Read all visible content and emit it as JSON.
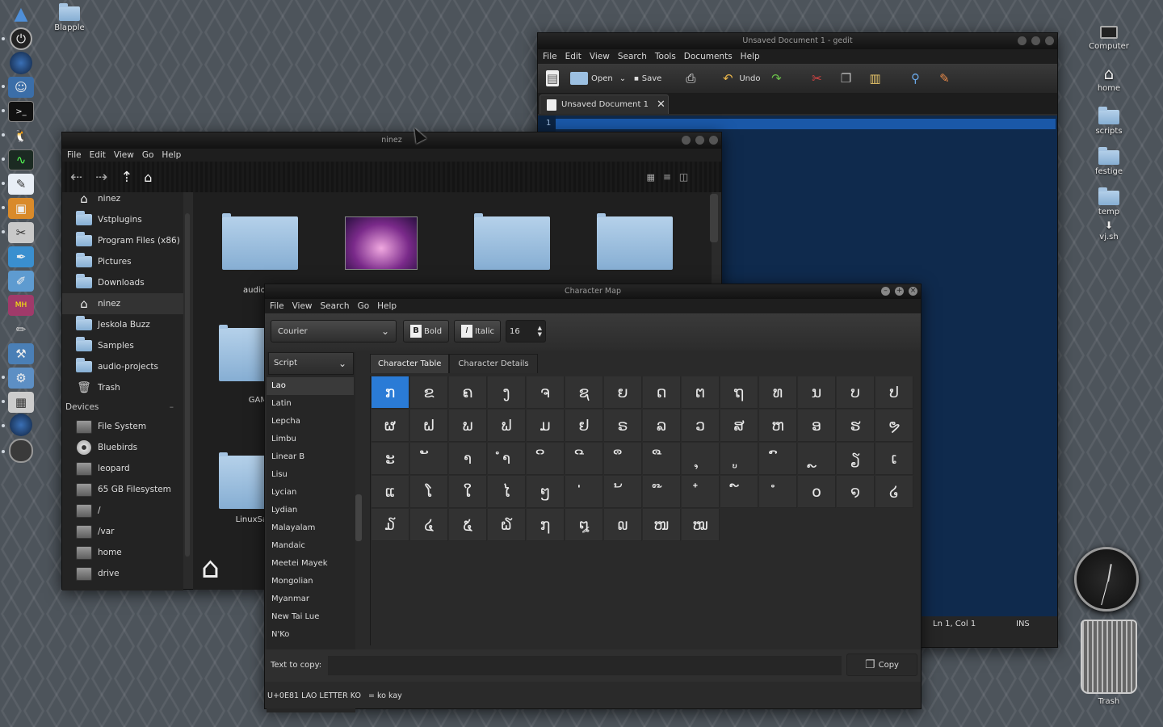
{
  "desktop": {
    "icons_left": [
      {
        "label": "Blapple"
      }
    ],
    "icons_right": [
      {
        "label": "Computer",
        "icon": "computer-icon"
      },
      {
        "label": "home",
        "icon": "home-icon"
      },
      {
        "label": "scripts",
        "icon": "folder-icon"
      },
      {
        "label": "festige",
        "icon": "folder-icon"
      },
      {
        "label": "temp",
        "icon": "folder-icon"
      },
      {
        "label": "vj.sh",
        "icon": "script-icon"
      }
    ],
    "trash_label": "Trash"
  },
  "gedit": {
    "title": "Unsaved Document 1 - gedit",
    "menu": [
      "File",
      "Edit",
      "View",
      "Search",
      "Tools",
      "Documents",
      "Help"
    ],
    "toolbar": {
      "open": "Open",
      "save": "Save",
      "undo": "Undo"
    },
    "tab_label": "Unsaved Document 1",
    "line_number": "1",
    "status": {
      "position": "Ln 1, Col 1",
      "mode": "INS"
    }
  },
  "nautilus": {
    "title": "ninez",
    "menu": [
      "File",
      "Edit",
      "View",
      "Go",
      "Help"
    ],
    "places": [
      {
        "label": "ninez",
        "type": "home"
      },
      {
        "label": "Vstplugins",
        "type": "folder"
      },
      {
        "label": "Program Files (x86)",
        "type": "folder"
      },
      {
        "label": "Pictures",
        "type": "folder"
      },
      {
        "label": "Downloads",
        "type": "folder"
      },
      {
        "label": "ninez",
        "type": "home"
      },
      {
        "label": "Jeskola Buzz",
        "type": "folder"
      },
      {
        "label": "Samples",
        "type": "folder"
      },
      {
        "label": "audio-projects",
        "type": "folder"
      },
      {
        "label": "Trash",
        "type": "trash"
      }
    ],
    "devices_header": "Devices",
    "devices": [
      "File System",
      "Bluebirds",
      "leopard",
      "65 GB Filesystem",
      "/",
      "/var",
      "home",
      "drive"
    ],
    "files": [
      {
        "label": "audio-pr"
      },
      {
        "label": ""
      },
      {
        "label": ""
      },
      {
        "label": ""
      },
      {
        "label": "GAM"
      },
      {
        "label": "LinuxSa"
      }
    ]
  },
  "charmap": {
    "title": "Character Map",
    "menu": [
      "File",
      "View",
      "Search",
      "Go",
      "Help"
    ],
    "font": "Courier",
    "bold_label": "Bold",
    "italic_label": "Italic",
    "size": "16",
    "group_by": "Script",
    "scripts": [
      "Lao",
      "Latin",
      "Lepcha",
      "Limbu",
      "Linear B",
      "Lisu",
      "Lycian",
      "Lydian",
      "Malayalam",
      "Mandaic",
      "Meetei Mayek",
      "Mongolian",
      "Myanmar",
      "New Tai Lue",
      "N'Ko"
    ],
    "selected_script": "Lao",
    "tabs": [
      "Character Table",
      "Character Details"
    ],
    "characters": [
      "ກ",
      "ຂ",
      "ຄ",
      "ງ",
      "ຈ",
      "ຊ",
      "ຍ",
      "ດ",
      "ຕ",
      "ຖ",
      "ທ",
      "ນ",
      "ບ",
      "ປ",
      "ຜ",
      "ຝ",
      "ພ",
      "ຟ",
      "ມ",
      "ຢ",
      "ຣ",
      "ລ",
      "ວ",
      "ສ",
      "ຫ",
      "ອ",
      "ຮ",
      "ຯ",
      "ະ",
      "ັ",
      "າ",
      "ຳ",
      "ິ",
      "ີ",
      "ຶ",
      "ື",
      "ຸ",
      "ູ",
      "ົ",
      "ຼ",
      "ຽ",
      "ເ",
      "ແ",
      "ໂ",
      "ໃ",
      "ໄ",
      "ໆ",
      "່",
      "້",
      "໊",
      "໋",
      "໌",
      "ໍ",
      "໐",
      "໑",
      "໒",
      "໓",
      "໔",
      "໕",
      "໖",
      "໗",
      "໘",
      "໙",
      "ໜ",
      "ໝ"
    ],
    "text_to_copy_label": "Text to copy:",
    "text_to_copy_value": "",
    "copy_label": "Copy",
    "status": "U+0E81 LAO LETTER KO   = ko kay"
  }
}
